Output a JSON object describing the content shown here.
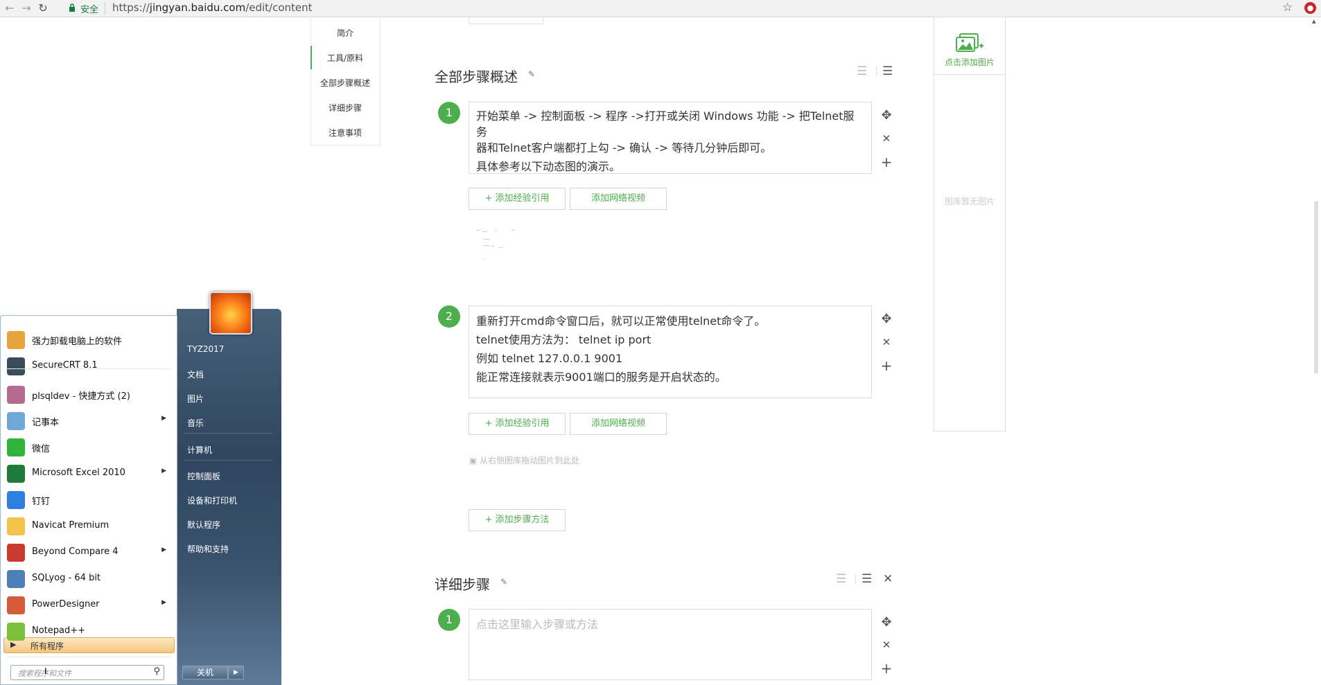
{
  "browser": {
    "secure_label": "安全",
    "url_scheme": "https://",
    "url_host": "jingyan.baidu.com",
    "url_path": "/edit/content"
  },
  "sidenav": {
    "items": [
      "简介",
      "工具/原料",
      "全部步骤概述",
      "详细步骤",
      "注意事项"
    ]
  },
  "overview": {
    "title": "全部步骤概述",
    "steps": [
      {
        "number": "1",
        "lines": [
          "开始菜单 -> 控制面板 -> 程序 ->打开或关闭 Windows 功能 -> 把Telnet服务",
          "器和Telnet客户端都打上勾 -> 确认 -> 等待几分钟后即可。",
          "具体参考以下动态图的演示。"
        ],
        "add_ref_label": "添加经验引用",
        "add_video_label": "添加网络视频"
      },
      {
        "number": "2",
        "lines": [
          "重新打开cmd命令窗口后，就可以正常使用telnet命令了。",
          "telnet使用方法为： telnet ip port",
          "例如 telnet 127.0.0.1 9001",
          "能正常连接就表示9001端口的服务是开启状态的。"
        ],
        "add_ref_label": "添加经验引用",
        "add_video_label": "添加网络视频",
        "drag_hint": "从右侧图库拖动图片到此处"
      }
    ],
    "add_method_label": "添加步骤方法"
  },
  "detail": {
    "title": "详细步骤",
    "step_number": "1",
    "placeholder": "点击这里输入步骤或方法"
  },
  "gallery": {
    "add_label": "点击添加图片",
    "empty_label": "图库暂无图片"
  },
  "startmenu": {
    "programs": [
      {
        "label": "强力卸载电脑上的软件",
        "icon": "uninstaller-icon",
        "color": "#e8a33c",
        "submenu": false
      },
      {
        "label": "SecureCRT 8.1",
        "icon": "securecrt-icon",
        "color": "#3a4b5c",
        "submenu": false
      },
      {
        "label": "plsqldev - 快捷方式 (2)",
        "icon": "plsqldev-icon",
        "color": "#b56a8f",
        "submenu": false
      },
      {
        "label": "记事本",
        "icon": "notepad-icon",
        "color": "#6fa7d8",
        "submenu": true
      },
      {
        "label": "微信",
        "icon": "wechat-icon",
        "color": "#2fb33a",
        "submenu": false
      },
      {
        "label": "Microsoft Excel 2010",
        "icon": "excel-icon",
        "color": "#1f7a3a",
        "submenu": true
      },
      {
        "label": "钉钉",
        "icon": "dingtalk-icon",
        "color": "#2f7fe0",
        "submenu": false
      },
      {
        "label": "Navicat Premium",
        "icon": "navicat-icon",
        "color": "#f2c24a",
        "submenu": false
      },
      {
        "label": "Beyond Compare 4",
        "icon": "beyond-compare-icon",
        "color": "#c93a2e",
        "submenu": true
      },
      {
        "label": "SQLyog - 64 bit",
        "icon": "sqlyog-icon",
        "color": "#4f7fb8",
        "submenu": false
      },
      {
        "label": "PowerDesigner",
        "icon": "powerdesigner-icon",
        "color": "#d45b3a",
        "submenu": true
      },
      {
        "label": "Notepad++",
        "icon": "notepadpp-icon",
        "color": "#7bbf3a",
        "submenu": false
      }
    ],
    "all_programs_label": "所有程序",
    "search_placeholder": "搜索程序和文件",
    "right_links": [
      "TYZ2017",
      "文档",
      "图片",
      "音乐",
      "计算机",
      "控制面板",
      "设备和打印机",
      "默认程序",
      "帮助和支持"
    ],
    "shutdown_label": "关机"
  }
}
